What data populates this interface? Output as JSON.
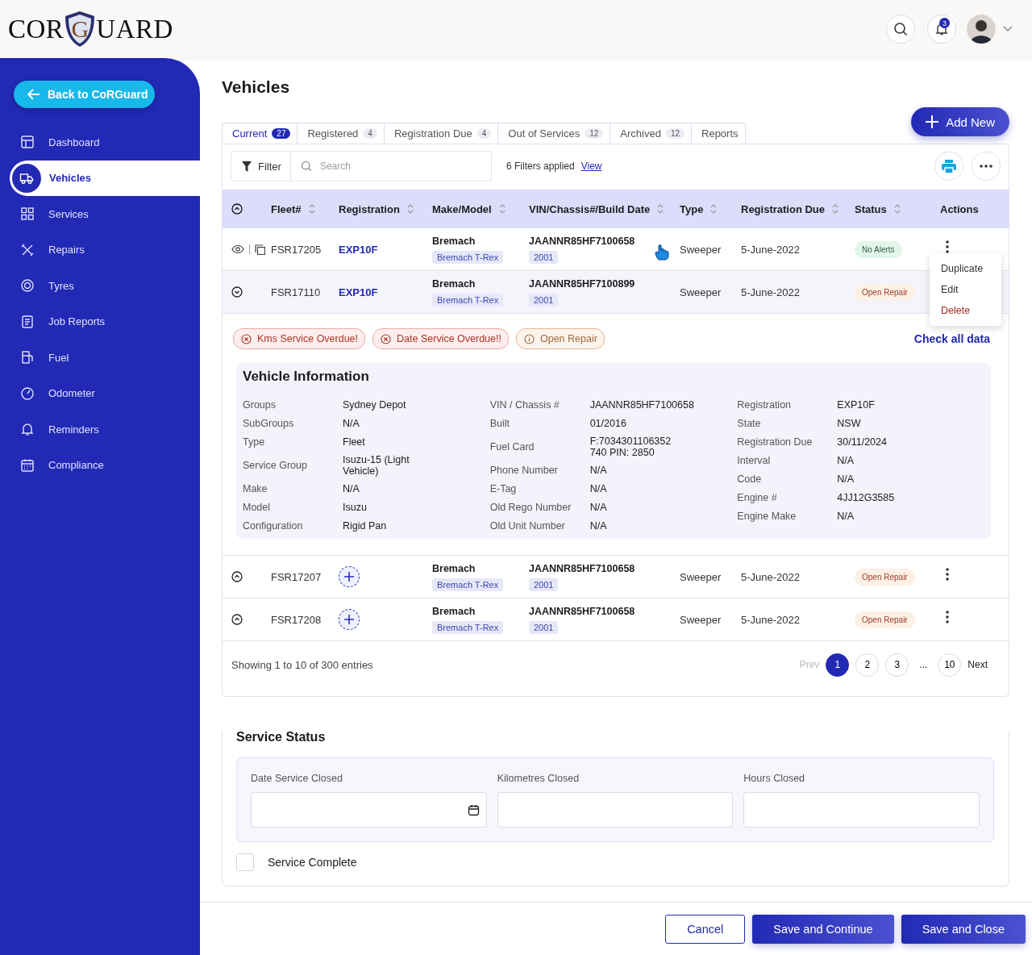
{
  "header": {
    "logo": {
      "left": "COR",
      "emblem_letter": "G",
      "right": "UARD"
    },
    "notification_count": "3"
  },
  "sidebar": {
    "back_button": "Back to CoRGuard",
    "items": [
      {
        "label": "Dashboard",
        "selected": false
      },
      {
        "label": "Vehicles",
        "selected": true
      },
      {
        "label": "Services",
        "selected": false
      },
      {
        "label": "Repairs",
        "selected": false
      },
      {
        "label": "Tyres",
        "selected": false
      },
      {
        "label": "Job Reports",
        "selected": false
      },
      {
        "label": "Fuel",
        "selected": false
      },
      {
        "label": "Odometer",
        "selected": false
      },
      {
        "label": "Reminders",
        "selected": false
      },
      {
        "label": "Compliance",
        "selected": false
      }
    ]
  },
  "page_title": "Vehicles",
  "add_button": "Add New",
  "tabs": [
    {
      "label": "Current",
      "count": "27",
      "selected": true
    },
    {
      "label": "Registered",
      "count": "4",
      "selected": false
    },
    {
      "label": "Registration Due",
      "count": "4",
      "selected": false
    },
    {
      "label": "Out of Services",
      "count": "12",
      "selected": false
    },
    {
      "label": "Archived",
      "count": "12",
      "selected": false
    },
    {
      "label": "Reports",
      "selected": false
    }
  ],
  "toolbar": {
    "filter_button": "Filter",
    "search_placeholder": "Search",
    "filters_text": "6 Filters applied",
    "filters_link": "View"
  },
  "table": {
    "columns": [
      {
        "label": "Fleet#",
        "sortable": true
      },
      {
        "label": "Registration",
        "sortable": true
      },
      {
        "label": "Make/Model",
        "sortable": true
      },
      {
        "label": "VIN/Chassis#/Build Date",
        "sortable": true
      },
      {
        "label": "Type",
        "sortable": true
      },
      {
        "label": "Registration Due",
        "sortable": true
      },
      {
        "label": "Status",
        "sortable": true
      },
      {
        "label": "Actions",
        "sortable": false
      }
    ],
    "rows": [
      {
        "kind": "view",
        "expanded": false,
        "fleet": "FSR17205",
        "registration": "EXP10F",
        "make": "Bremach",
        "model": "Bremach T-Rex",
        "vin": "JAANNR85HF7100658",
        "year": "2001",
        "pointer_over": true,
        "type": "Sweeper",
        "due": "5-June-2022",
        "status": {
          "label": "No Alerts",
          "kind": "ok"
        },
        "menu": [
          {
            "label": "Duplicate",
            "kind": "normal"
          },
          {
            "label": "Edit",
            "kind": "normal"
          },
          {
            "label": "Delete",
            "kind": "danger"
          }
        ]
      },
      {
        "kind": "toggle",
        "expanded": true,
        "fleet": "FSR17110",
        "registration": "EXP10F",
        "make": "Bremach",
        "model": "Bremach T-Rex",
        "vin": "JAANNR85HF7100899",
        "year": "2001",
        "pointer_over": false,
        "type": "Sweeper",
        "due": "5-June-2022",
        "status": {
          "label": "Open Repair",
          "kind": "repair"
        },
        "details": {
          "alerts": [
            {
              "label": "Kms Service Overdue!",
              "kind": "error"
            },
            {
              "label": "Date Service Overdue!!",
              "kind": "error"
            },
            {
              "label": "Open Repair",
              "kind": "warning"
            }
          ],
          "link": "Check all data",
          "title": "Vehicle Information",
          "groups": [
            [
              {
                "label": "Groups",
                "value": "Sydney Depot"
              },
              {
                "label": "SubGroups",
                "value": "N/A"
              },
              {
                "label": "Type",
                "value": "Fleet"
              },
              {
                "label": "Service Group",
                "value": "Isuzu-15 (Light Vehicle)"
              },
              {
                "label": "Make",
                "value": "N/A"
              },
              {
                "label": "Model",
                "value": "Isuzu"
              },
              {
                "label": "Configuration",
                "value": "Rigid Pan"
              }
            ],
            [
              {
                "label": "VIN / Chassis #",
                "value": "JAANNR85HF7100658"
              },
              {
                "label": "Built",
                "value": "01/2016"
              },
              {
                "label": "Fuel Card",
                "value": "F:7034301106352\n740 PIN: 2850"
              },
              {
                "label": "Phone Number",
                "value": "N/A"
              },
              {
                "label": "E-Tag",
                "value": "N/A"
              },
              {
                "label": "Old Rego Number",
                "value": "N/A"
              },
              {
                "label": "Old Unit Number",
                "value": "N/A"
              }
            ],
            [
              {
                "label": "Registration",
                "value": "EXP10F"
              },
              {
                "label": "State",
                "value": "NSW"
              },
              {
                "label": "Registration Due",
                "value": "30/11/2024"
              },
              {
                "label": "Interval",
                "value": "N/A"
              },
              {
                "label": "Code",
                "value": "N/A"
              },
              {
                "label": "Engine #",
                "value": "4JJ12G3585"
              },
              {
                "label": "Engine Make",
                "value": "N/A"
              }
            ]
          ]
        }
      },
      {
        "kind": "toggle",
        "expanded": false,
        "fleet": "FSR17207",
        "make": "Bremach",
        "model": "Bremach T-Rex",
        "vin": "JAANNR85HF7100658",
        "year": "2001",
        "pointer_over": false,
        "type": "Sweeper",
        "due": "5-June-2022",
        "status": {
          "label": "Open Repair",
          "kind": "repair"
        }
      },
      {
        "kind": "toggle",
        "expanded": false,
        "fleet": "FSR17208",
        "make": "Bremach",
        "model": "Bremach T-Rex",
        "vin": "JAANNR85HF7100658",
        "year": "2001",
        "pointer_over": false,
        "type": "Sweeper",
        "due": "5-June-2022",
        "status": {
          "label": "Open Repair",
          "kind": "repair"
        }
      }
    ]
  },
  "pagination": {
    "summary": "Showing 1 to 10 of 300 entries",
    "prev": {
      "label": "Prev",
      "disabled": true
    },
    "pages": [
      {
        "label": "1",
        "selected": true
      },
      {
        "label": "2",
        "selected": false
      },
      {
        "label": "3",
        "selected": false
      },
      {
        "label": "...",
        "kind": "gap"
      },
      {
        "label": "10",
        "selected": false
      }
    ],
    "next": {
      "label": "Next",
      "disabled": false
    }
  },
  "service_status": {
    "title": "Service Status",
    "fields": [
      {
        "label": "Date Service Closed",
        "kind": "date"
      },
      {
        "label": "Kilometres Closed",
        "kind": "text"
      },
      {
        "label": "Hours Closed",
        "kind": "text"
      }
    ],
    "checkbox": {
      "label": "Service Complete",
      "checked": false
    }
  },
  "footer_buttons": [
    {
      "label": "Cancel",
      "kind": "outline"
    },
    {
      "label": "Save and Continue",
      "kind": "primary"
    },
    {
      "label": "Save and Close",
      "kind": "primary"
    }
  ]
}
